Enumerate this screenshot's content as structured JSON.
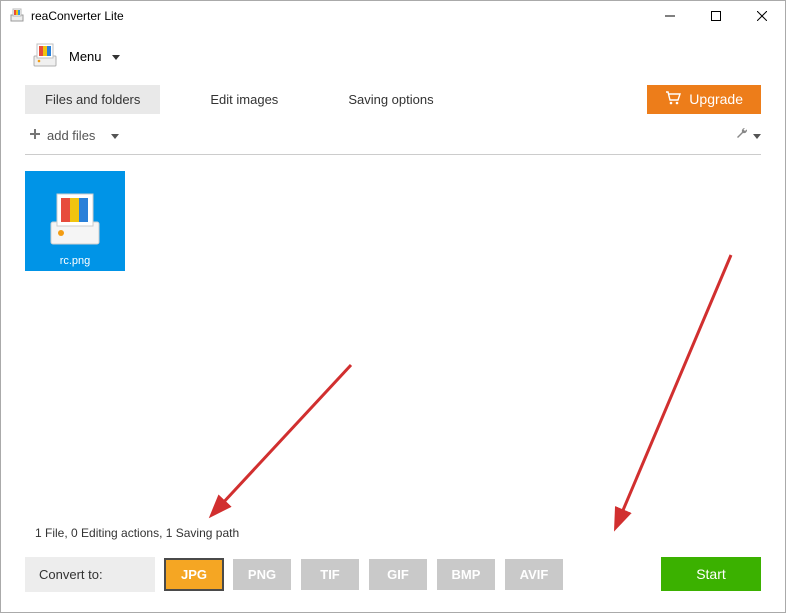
{
  "window": {
    "title": "reaConverter Lite"
  },
  "menu": {
    "label": "Menu"
  },
  "tabs": [
    {
      "label": "Files and folders",
      "active": true
    },
    {
      "label": "Edit images",
      "active": false
    },
    {
      "label": "Saving options",
      "active": false
    }
  ],
  "upgrade": {
    "label": "Upgrade"
  },
  "toolbar": {
    "add_files": "add files"
  },
  "files": [
    {
      "name": "rc.png"
    }
  ],
  "status_text": "1 File,  0 Editing actions,  1 Saving path",
  "convert": {
    "label": "Convert to:",
    "formats": [
      "JPG",
      "PNG",
      "TIF",
      "GIF",
      "BMP",
      "AVIF"
    ],
    "selected": "JPG"
  },
  "start": {
    "label": "Start"
  },
  "colors": {
    "accent_orange": "#ed7d1a",
    "accent_green": "#3bb100",
    "tile_blue": "#0094e7",
    "fmt_active": "#f5a623"
  }
}
